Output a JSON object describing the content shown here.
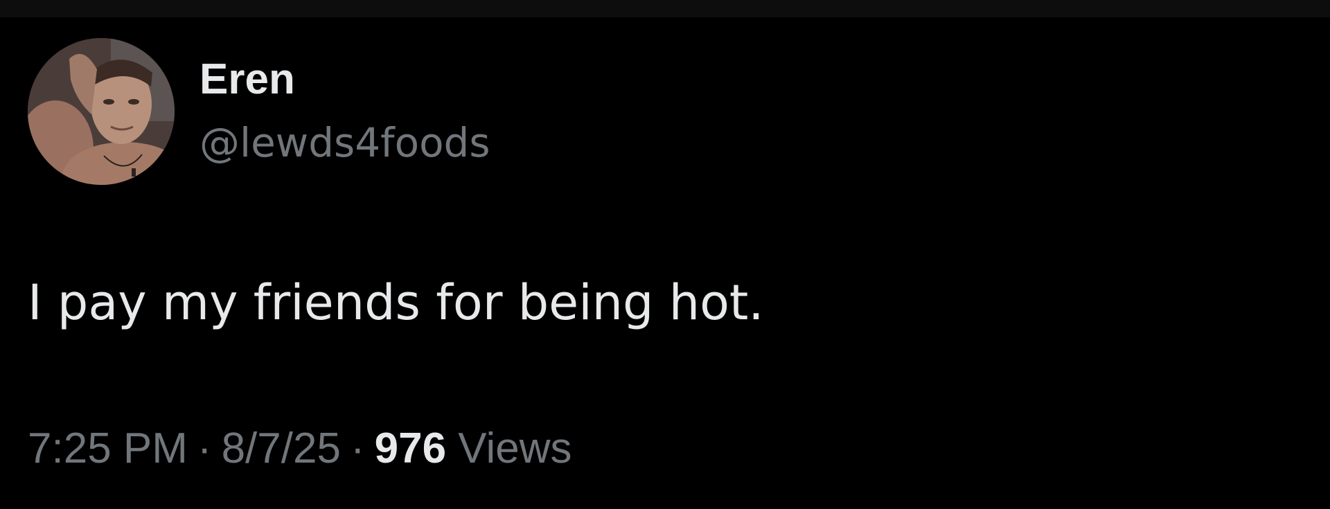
{
  "tweet": {
    "author": {
      "display_name": "Eren",
      "handle": "@lewds4foods"
    },
    "text": "I pay my friends for being hot.",
    "meta": {
      "time": "7:25 PM",
      "date": "8/7/25",
      "separator": "·",
      "views_count": "976",
      "views_label": "Views"
    }
  },
  "colors": {
    "background": "#000000",
    "primary_text": "#e7e9ea",
    "secondary_text": "#71767b"
  }
}
